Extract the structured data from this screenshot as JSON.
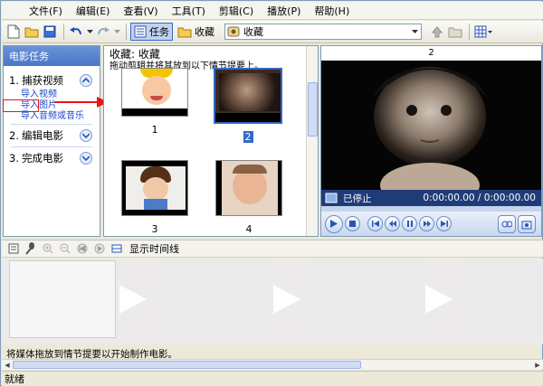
{
  "menu": [
    "文件(F)",
    "编辑(E)",
    "查看(V)",
    "工具(T)",
    "剪辑(C)",
    "播放(P)",
    "帮助(H)"
  ],
  "toolbar": {
    "tasks_label": "任务",
    "collections_label": "收藏",
    "collection_combo_value": "收藏"
  },
  "task_pane": {
    "header": "电影任务",
    "sections": [
      {
        "num": "1.",
        "label": "捕获视频",
        "links": [
          "导入视频",
          "导入图片",
          "导入音频或音乐"
        ]
      },
      {
        "num": "2.",
        "label": "编辑电影"
      },
      {
        "num": "3.",
        "label": "完成电影"
      }
    ]
  },
  "collection": {
    "title": "收藏: 收藏",
    "hint": "拖动剪辑并将其放到以下情节提要上。",
    "clips": [
      {
        "caption": "1"
      },
      {
        "caption": "2"
      },
      {
        "caption": "3"
      },
      {
        "caption": "4"
      }
    ]
  },
  "monitor": {
    "header": "2",
    "status": "已停止",
    "time": "0:00:00.00 / 0:00:00.00"
  },
  "timeline": {
    "show_label": "显示时间线",
    "hint": "将媒体拖放到情节提要以开始制作电影。"
  },
  "statusbar": {
    "text": "就绪"
  },
  "colors": {
    "accent": "#316ac5",
    "annotation": "#e8161a"
  }
}
